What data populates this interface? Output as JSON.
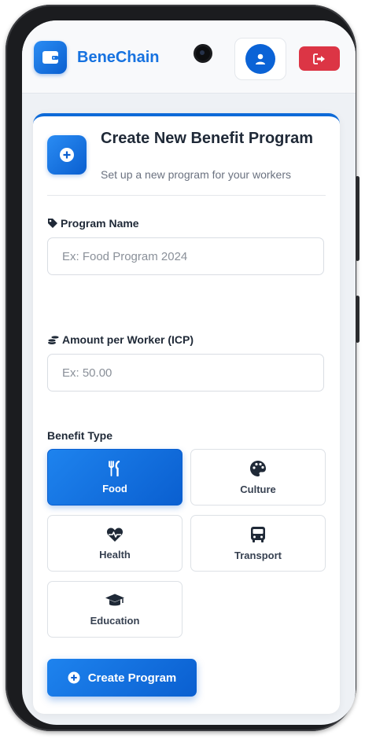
{
  "header": {
    "brand": "BeneChain",
    "logo_icon": "wallet-icon",
    "user_icon": "user-icon",
    "logout_icon": "logout-icon",
    "accent": "#1672e0",
    "logout_color": "#dc3545"
  },
  "form": {
    "title": "Create New Benefit Program",
    "subtitle": "Set up a new program for your workers",
    "header_icon": "plus-circle-icon",
    "program_name_label": "Program Name",
    "program_name_icon": "tag-icon",
    "program_name_placeholder": "Ex: Food Program 2024",
    "program_name_value": "",
    "amount_label": "Amount per Worker (ICP)",
    "amount_icon": "coins-icon",
    "amount_placeholder": "Ex: 50.00",
    "amount_value": "",
    "benefit_type_label": "Benefit Type",
    "benefit_types": [
      {
        "label": "Food",
        "icon": "utensils-icon",
        "selected": true
      },
      {
        "label": "Culture",
        "icon": "palette-icon",
        "selected": false
      },
      {
        "label": "Health",
        "icon": "heartbeat-icon",
        "selected": false
      },
      {
        "label": "Transport",
        "icon": "bus-icon",
        "selected": false
      },
      {
        "label": "Education",
        "icon": "graduation-cap-icon",
        "selected": false
      }
    ],
    "submit_label": "Create Program",
    "submit_icon": "plus-circle-icon"
  }
}
